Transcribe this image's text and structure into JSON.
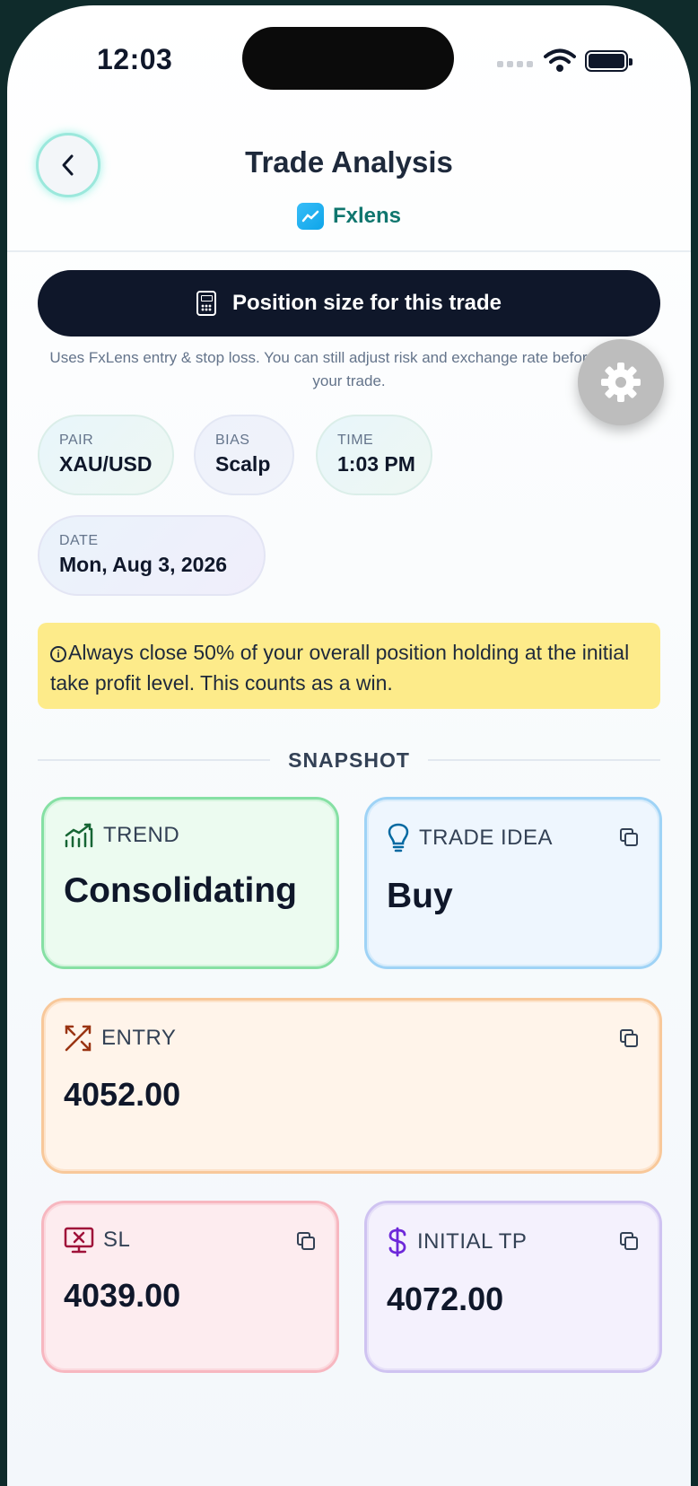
{
  "status_bar": {
    "time": "12:03"
  },
  "header": {
    "title": "Trade Analysis",
    "brand": "Fxlens"
  },
  "position_button": {
    "label": "Position size for this trade"
  },
  "position_note": "Uses FxLens entry & stop loss. You can still adjust risk and exchange rate before placing your trade.",
  "chips": {
    "pair": {
      "key": "PAIR",
      "value": "XAU/USD"
    },
    "bias": {
      "key": "BIAS",
      "value": "Scalp"
    },
    "time": {
      "key": "TIME",
      "value": "1:03 PM"
    },
    "date": {
      "key": "DATE",
      "value": "Mon, Aug 3, 2026"
    }
  },
  "alert": "Always close 50% of your overall position holding at the initial take profit level. This counts as a win.",
  "snapshot_label": "SNAPSHOT",
  "cards": {
    "trend": {
      "label": "TREND",
      "value": "Consolidating",
      "accent": "#166534"
    },
    "trade_idea": {
      "label": "TRADE IDEA",
      "value": "Buy",
      "accent": "#0369a1"
    },
    "entry": {
      "label": "ENTRY",
      "value": "4052.00",
      "accent": "#9a3412"
    },
    "sl": {
      "label": "SL",
      "value": "4039.00",
      "accent": "#9f1239"
    },
    "initial_tp": {
      "label": "INITIAL TP",
      "value": "4072.00",
      "accent": "#6d28d9"
    }
  },
  "icons": {
    "back": "chevron-left-icon",
    "calculator": "calculator-icon",
    "settings": "gear-icon",
    "trend": "trend-chart-icon",
    "trade_idea": "lightbulb-icon",
    "entry": "crosshair-arrow-icon",
    "sl": "monitor-x-icon",
    "tp": "dollar-icon",
    "copy": "copy-icon"
  }
}
